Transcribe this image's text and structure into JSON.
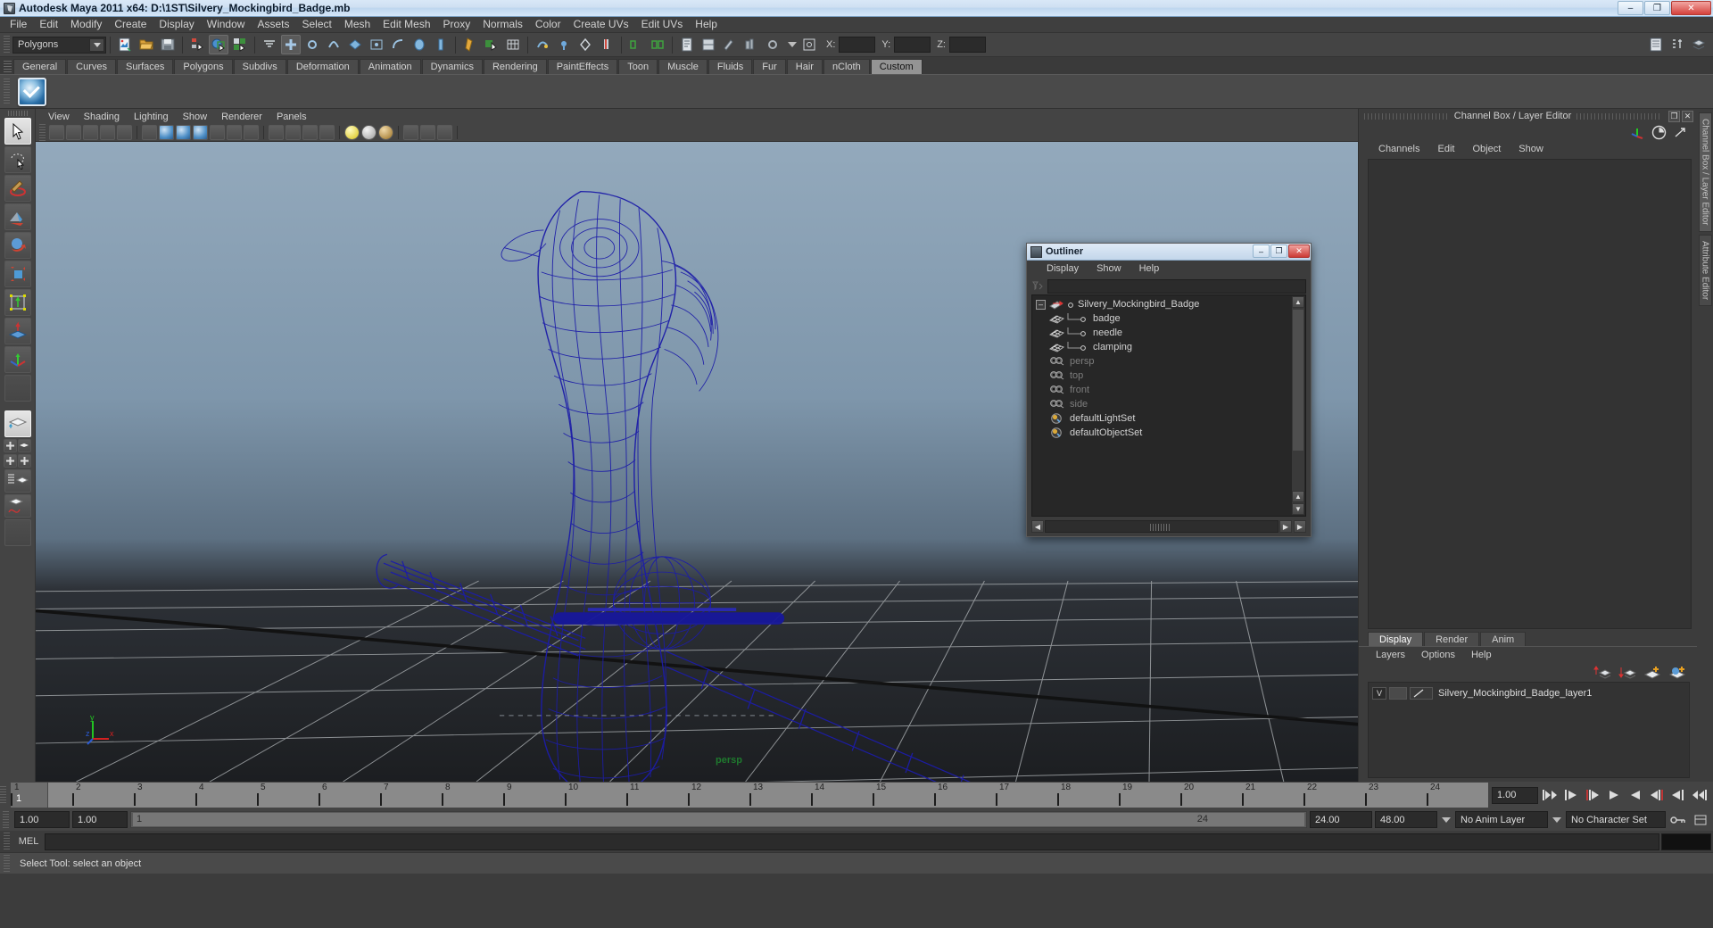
{
  "window": {
    "title": "Autodesk Maya 2011 x64: D:\\1ST\\Silvery_Mockingbird_Badge.mb",
    "minimize": "–",
    "restore": "❐",
    "close": "✕"
  },
  "menubar": {
    "items": [
      "File",
      "Edit",
      "Modify",
      "Create",
      "Display",
      "Window",
      "Assets",
      "Select",
      "Mesh",
      "Edit Mesh",
      "Proxy",
      "Normals",
      "Color",
      "Create UVs",
      "Edit UVs",
      "Help"
    ]
  },
  "statusline": {
    "mode_menu": "Polygons",
    "x_label": "X:",
    "y_label": "Y:",
    "z_label": "Z:",
    "x_value": "",
    "y_value": "",
    "z_value": ""
  },
  "shelf": {
    "tabs": [
      "General",
      "Curves",
      "Surfaces",
      "Polygons",
      "Subdivs",
      "Deformation",
      "Animation",
      "Dynamics",
      "Rendering",
      "PaintEffects",
      "Toon",
      "Muscle",
      "Fluids",
      "Fur",
      "Hair",
      "nCloth",
      "Custom"
    ],
    "active_tab": "Custom"
  },
  "viewport": {
    "menu": [
      "View",
      "Shading",
      "Lighting",
      "Show",
      "Renderer",
      "Panels"
    ],
    "camera_label": "persp",
    "axis": {
      "x": "x",
      "y": "y",
      "z": "z"
    }
  },
  "outliner": {
    "title": "Outliner",
    "menu": [
      "Display",
      "Show",
      "Help"
    ],
    "search_value": "",
    "items": [
      {
        "label": "Silvery_Mockingbird_Badge",
        "type": "transform",
        "depth": 0,
        "dim": false,
        "expander": "–"
      },
      {
        "label": "badge",
        "type": "mesh",
        "depth": 1,
        "dim": false
      },
      {
        "label": "needle",
        "type": "mesh",
        "depth": 1,
        "dim": false
      },
      {
        "label": "clamping",
        "type": "mesh",
        "depth": 1,
        "dim": false
      },
      {
        "label": "persp",
        "type": "camera",
        "depth": 0,
        "dim": true
      },
      {
        "label": "top",
        "type": "camera",
        "depth": 0,
        "dim": true
      },
      {
        "label": "front",
        "type": "camera",
        "depth": 0,
        "dim": true
      },
      {
        "label": "side",
        "type": "camera",
        "depth": 0,
        "dim": true
      },
      {
        "label": "defaultLightSet",
        "type": "set",
        "depth": 0,
        "dim": false
      },
      {
        "label": "defaultObjectSet",
        "type": "set",
        "depth": 0,
        "dim": false
      }
    ]
  },
  "channelbox": {
    "dock_title": "Channel Box / Layer Editor",
    "menu": [
      "Channels",
      "Edit",
      "Object",
      "Show"
    ],
    "content": ""
  },
  "layer_editor": {
    "tabs": [
      "Display",
      "Render",
      "Anim"
    ],
    "active_tab": "Display",
    "menu": [
      "Layers",
      "Options",
      "Help"
    ],
    "layers": [
      {
        "visible": "V",
        "playback": "",
        "name": "Silvery_Mockingbird_Badge_layer1"
      }
    ]
  },
  "right_tabs": [
    "Channel Box / Layer Editor",
    "Attribute Editor"
  ],
  "timeline": {
    "current_frame": "1",
    "ticks": [
      1,
      2,
      3,
      4,
      5,
      6,
      7,
      8,
      9,
      10,
      11,
      12,
      13,
      14,
      15,
      16,
      17,
      18,
      19,
      20,
      21,
      22,
      23,
      24
    ],
    "current_time_field": "1.00"
  },
  "range": {
    "start": "1.00",
    "end": "1.00",
    "range_start_label": "1",
    "range_end_label": "24",
    "playback_end": "24.00",
    "anim_end": "48.00",
    "anim_layer": "No Anim Layer",
    "character_set": "No Character Set"
  },
  "command": {
    "label": "MEL",
    "value": ""
  },
  "statusbar": {
    "message": "Select Tool: select an object"
  },
  "colors": {
    "wireframe": "#1c1ca8",
    "grid": "#9a9a9a",
    "accent_green": "#1f7a2e",
    "panel_bg": "#3c3c3c",
    "shelf_bg": "#4a4a4a"
  }
}
